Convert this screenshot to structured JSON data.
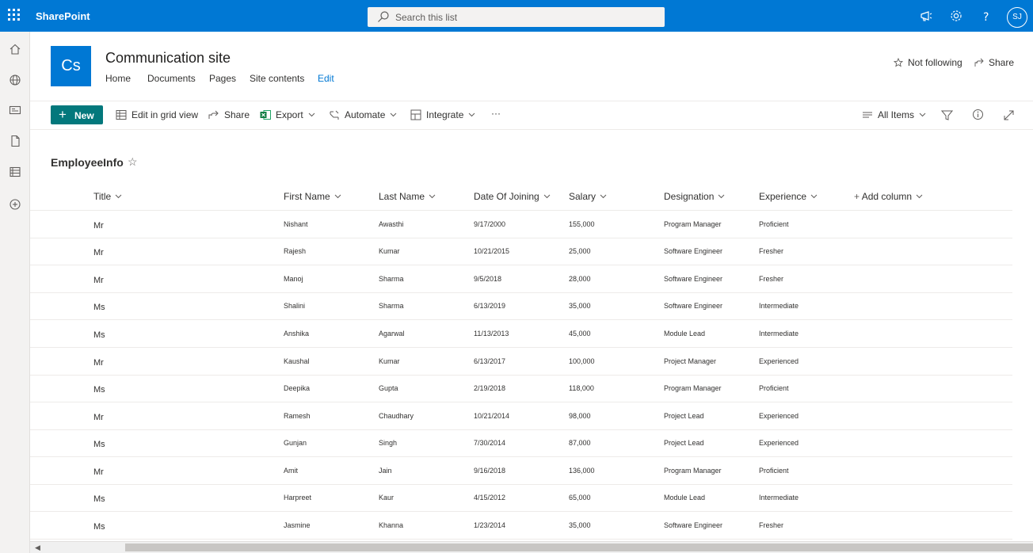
{
  "suite": {
    "brand": "SharePoint",
    "search_placeholder": "Search this list",
    "avatar_initials": "SJ"
  },
  "site": {
    "logo_text": "Cs",
    "title": "Communication site",
    "nav": [
      "Home",
      "Documents",
      "Pages",
      "Site contents",
      "Edit"
    ],
    "follow_label": "Not following",
    "share_label": "Share"
  },
  "commandbar": {
    "new": "New",
    "edit_grid": "Edit in grid view",
    "share": "Share",
    "export": "Export",
    "automate": "Automate",
    "integrate": "Integrate",
    "more": "···",
    "view": "All Items"
  },
  "list": {
    "title": "EmployeeInfo",
    "columns": [
      "Title",
      "First Name",
      "Last Name",
      "Date Of Joining",
      "Salary",
      "Designation",
      "Experience",
      "Add column"
    ],
    "rows": [
      [
        "Mr",
        "Nishant",
        "Awasthi",
        "9/17/2000",
        "155,000",
        "Program Manager",
        "Proficient"
      ],
      [
        "Mr",
        "Rajesh",
        "Kumar",
        "10/21/2015",
        "25,000",
        "Software Engineer",
        "Fresher"
      ],
      [
        "Mr",
        "Manoj",
        "Sharma",
        "9/5/2018",
        "28,000",
        "Software Engineer",
        "Fresher"
      ],
      [
        "Ms",
        "Shalini",
        "Sharma",
        "6/13/2019",
        "35,000",
        "Software Engineer",
        "Intermediate"
      ],
      [
        "Ms",
        "Anshika",
        "Agarwal",
        "11/13/2013",
        "45,000",
        "Module Lead",
        "Intermediate"
      ],
      [
        "Mr",
        "Kaushal",
        "Kumar",
        "6/13/2017",
        "100,000",
        "Project Manager",
        "Experienced"
      ],
      [
        "Ms",
        "Deepika",
        "Gupta",
        "2/19/2018",
        "118,000",
        "Program Manager",
        "Proficient"
      ],
      [
        "Mr",
        "Ramesh",
        "Chaudhary",
        "10/21/2014",
        "98,000",
        "Project Lead",
        "Experienced"
      ],
      [
        "Ms",
        "Gunjan",
        "Singh",
        "7/30/2014",
        "87,000",
        "Project Lead",
        "Experienced"
      ],
      [
        "Mr",
        "Amit",
        "Jain",
        "9/16/2018",
        "136,000",
        "Program Manager",
        "Proficient"
      ],
      [
        "Ms",
        "Harpreet",
        "Kaur",
        "4/15/2012",
        "65,000",
        "Module Lead",
        "Intermediate"
      ],
      [
        "Ms",
        "Jasmine",
        "Khanna",
        "1/23/2014",
        "35,000",
        "Software Engineer",
        "Fresher"
      ]
    ]
  },
  "icons": {
    "waffle": "app-launcher-icon",
    "search": "search-icon",
    "megaphone": "megaphone-icon",
    "settings": "gear-icon",
    "help": "help-icon"
  },
  "colors": {
    "suitebar": "#0078d4",
    "new_button": "#03787c",
    "accent": "#0078d4"
  }
}
